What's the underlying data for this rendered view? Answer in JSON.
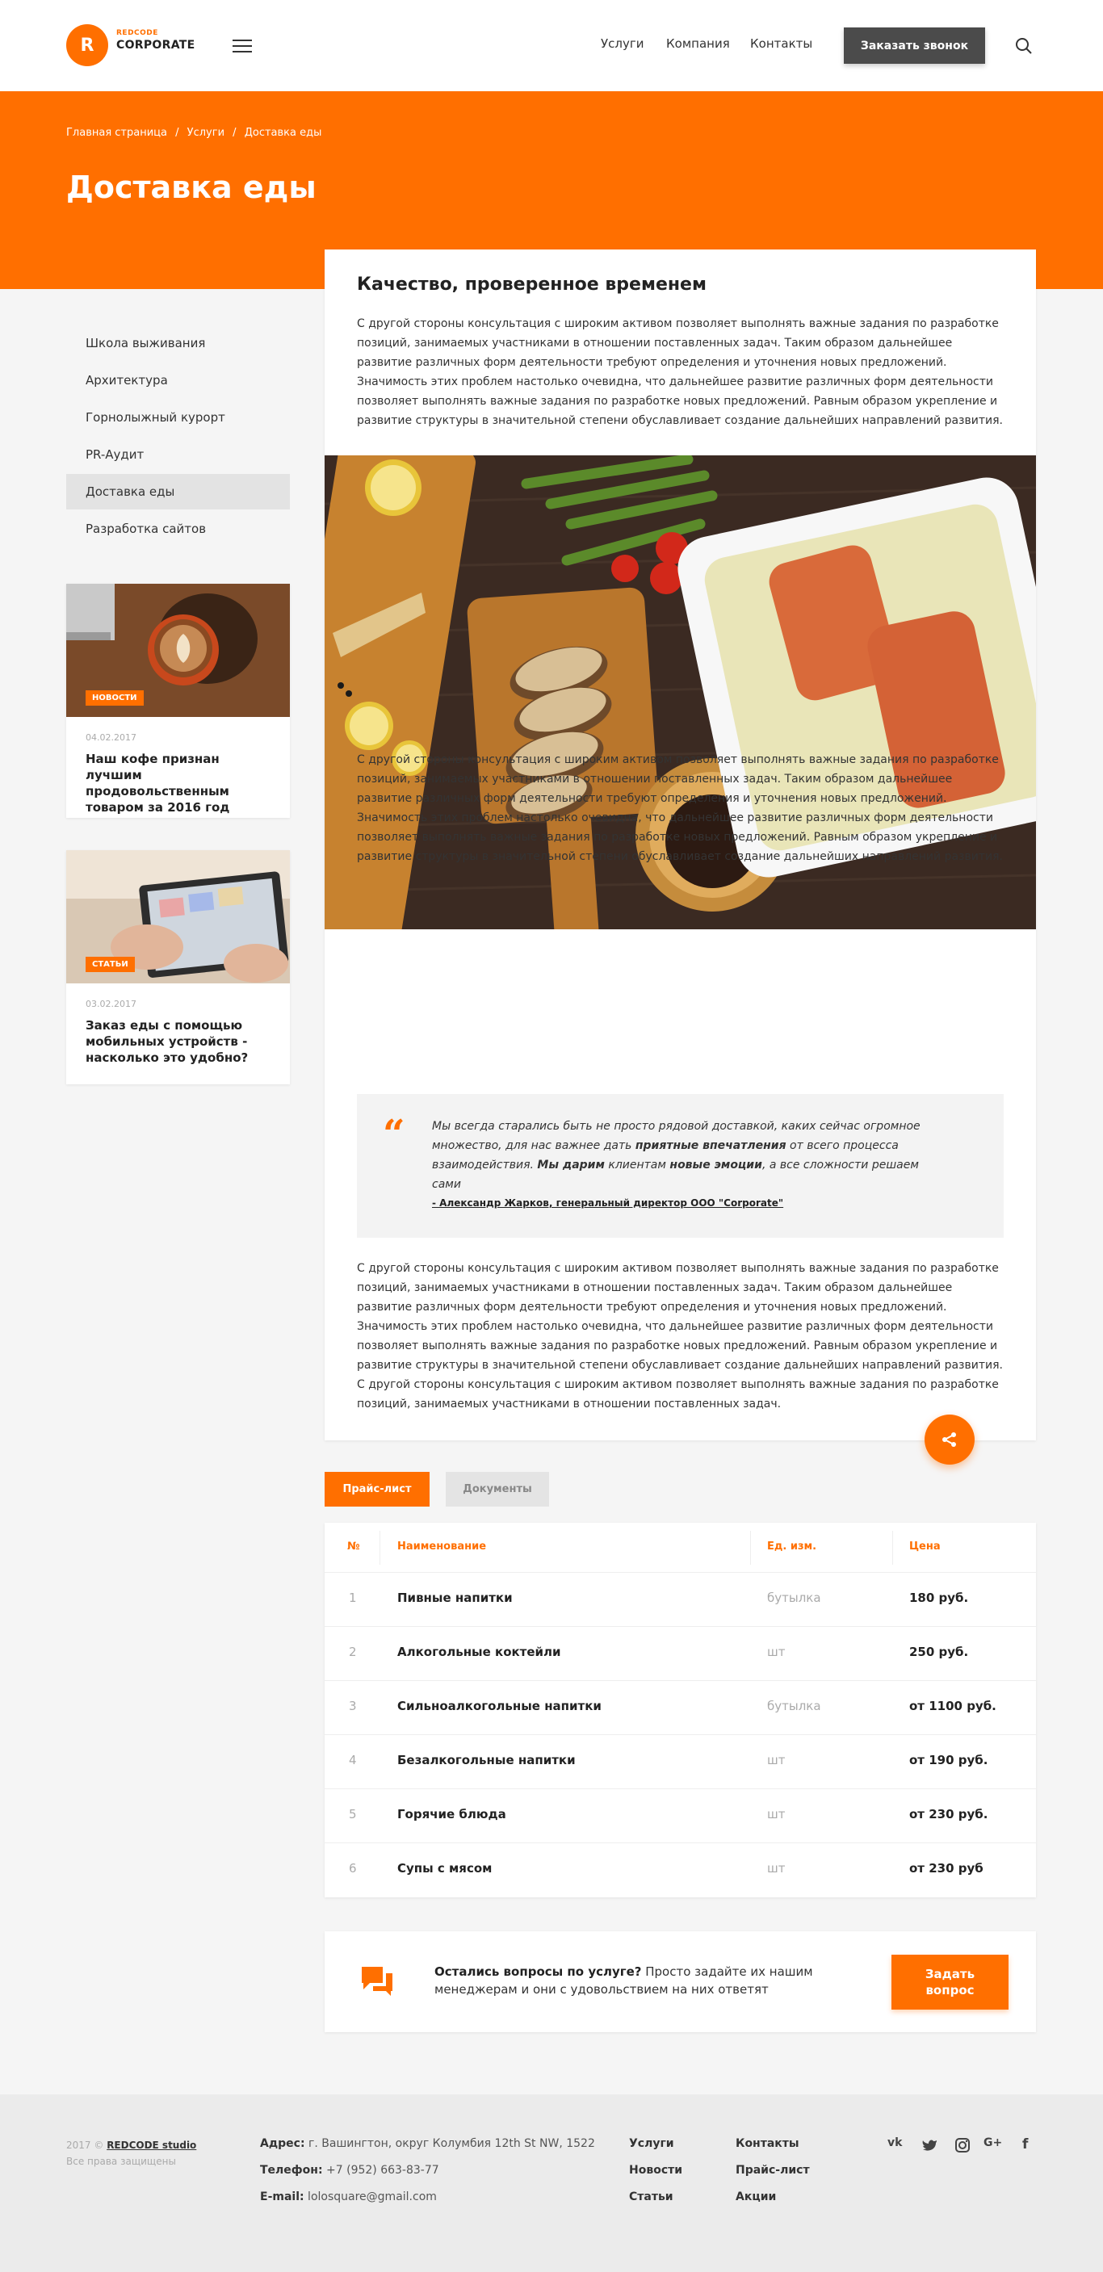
{
  "header": {
    "logo_letter": "R",
    "logo_small": "REDCODE",
    "logo_big": "CORPORATE",
    "nav": [
      "Услуги",
      "Компания",
      "Контакты"
    ],
    "call_button": "Заказать звонок"
  },
  "hero": {
    "breadcrumbs": [
      "Главная страница",
      "/",
      "Услуги",
      "/",
      "Доставка еды"
    ],
    "title": "Доставка еды"
  },
  "sidebar": {
    "items": [
      "Школа выживания",
      "Архитектура",
      "Горнолыжный курорт",
      "PR-Аудит",
      "Доставка еды",
      "Разработка сайтов"
    ],
    "active_index": 4,
    "news": [
      {
        "tag": "НОВОСТИ",
        "date": "04.02.2017",
        "title": "Наш кофе признан лучшим продовольственным товаром за 2016 год"
      },
      {
        "tag": "СТАТЬИ",
        "date": "03.02.2017",
        "title": "Заказ еды с помощью мобильных устройств - насколько это удобно?"
      }
    ]
  },
  "content": {
    "heading": "Качество, проверенное временем",
    "paragraph1": "С другой стороны консультация с широким активом позволяет выполнять важные задания по разработке позиций, занимаемых участниками в отношении поставленных задач. Таким образом дальнейшее развитие различных форм деятельности требуют определения и уточнения новых предложений. Значимость этих проблем настолько очевидна, что дальнейшее развитие различных форм деятельности позволяет выполнять важные задания по разработке новых предложений. Равным образом укрепление и развитие структуры в значительной степени обуславливает создание дальнейших направлений развития.",
    "paragraph2": "С другой стороны консультация с широким активом позволяет выполнять важные задания по разработке позиций, занимаемых участниками в отношении поставленных задач. Таким образом дальнейшее развитие различных форм деятельности требуют определения и уточнения новых предложений. Значимость этих проблем настолько очевидна, что дальнейшее развитие различных форм деятельности позволяет выполнять важные задания по разработке новых предложений. Равным образом укрепление и развитие структуры в значительной степени обуславливает создание дальнейших направлений развития.",
    "quote": {
      "mark": "“",
      "part1": "Мы всегда старались быть не просто рядовой доставкой, каких сейчас огромное множество, для нас важнее дать ",
      "bold1": "приятные впечатления",
      "part2": " от всего процесса взаимодействия. ",
      "bold2": "Мы дарим",
      "part3": " клиентам ",
      "bold3": "новые эмоции",
      "part4": ", а все сложности решаем сами",
      "author": "- Александр Жарков, генеральный директор ООО \"Corporate\""
    },
    "paragraph3": "С другой стороны консультация с широким активом позволяет выполнять важные задания по разработке позиций, занимаемых участниками в отношении поставленных задач. Таким образом дальнейшее развитие различных форм деятельности требуют определения и уточнения новых предложений. Значимость этих проблем настолько очевидна, что дальнейшее развитие различных форм деятельности позволяет выполнять важные задания по разработке новых предложений. Равным образом укрепление и развитие структуры в значительной степени обуславливает создание дальнейших направлений развития. С другой стороны консультация с широким активом позволяет выполнять важные задания по разработке позиций, занимаемых участниками в отношении поставленных задач."
  },
  "tabs": [
    "Прайс-лист",
    "Документы"
  ],
  "price_table": {
    "headers": [
      "№",
      "Наименование",
      "Ед. изм.",
      "Цена"
    ],
    "rows": [
      {
        "num": "1",
        "name": "Пивные напитки",
        "unit": "бутылка",
        "price": "180 руб."
      },
      {
        "num": "2",
        "name": "Алкогольные коктейли",
        "unit": "шт",
        "price": "250 руб."
      },
      {
        "num": "3",
        "name": "Сильноалкогольные напитки",
        "unit": "бутылка",
        "price": "от 1100 руб."
      },
      {
        "num": "4",
        "name": "Безалкогольные напитки",
        "unit": "шт",
        "price": "от 190 руб."
      },
      {
        "num": "5",
        "name": "Горячие блюда",
        "unit": "шт",
        "price": "от 230 руб."
      },
      {
        "num": "6",
        "name": "Супы с мясом",
        "unit": "шт",
        "price": "от 230 руб"
      }
    ]
  },
  "question": {
    "bold": "Остались вопросы по услуге?",
    "text": " Просто задайте их нашим менеджерам и они с удовольствием на них ответят",
    "button_line1": "Задать",
    "button_line2": "вопрос"
  },
  "footer": {
    "copyright_prefix": "2017 ©",
    "studio": "REDCODE studio",
    "rights": "Все права защищены",
    "address_label": "Адрес:",
    "address": " г. Вашингтон, округ Колумбия 12th St NW, 1522",
    "phone_label": "Телефон:",
    "phone": " +7 (952) 663-83-77",
    "email_label": "E-mail:",
    "email": " lolosquare@gmail.com",
    "col1": [
      "Услуги",
      "Новости",
      "Статьи"
    ],
    "col2": [
      "Контакты",
      "Прайс-лист",
      "Акции"
    ],
    "socials": [
      "vk-icon",
      "twitter-icon",
      "instagram-icon",
      "google-plus-icon",
      "facebook-icon"
    ]
  },
  "colors": {
    "accent": "#ff6f00",
    "dark_button": "#4b4b4b"
  }
}
